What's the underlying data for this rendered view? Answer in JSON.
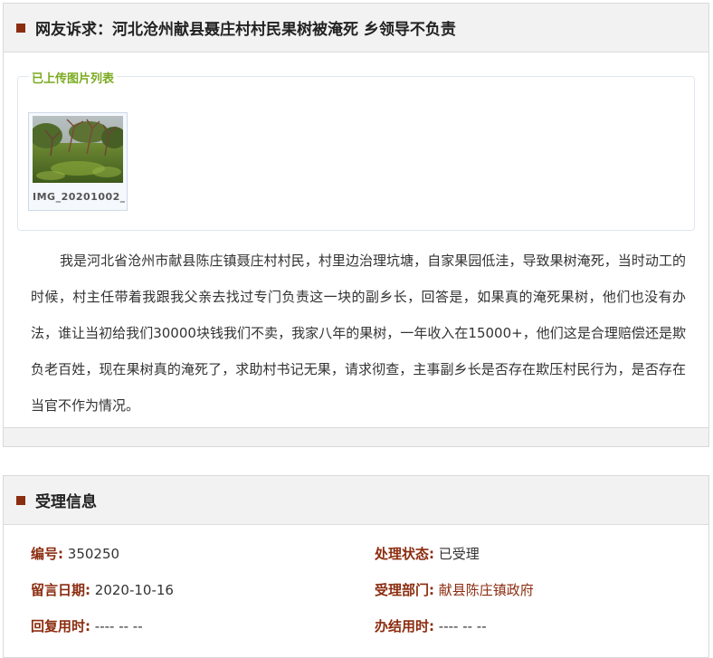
{
  "complaint": {
    "title": "网友诉求：河北沧州献县聂庄村村民果树被淹死 乡领导不负责",
    "uploaded_label": "已上传图片列表",
    "image_filename": "IMG_20201002_1",
    "body": "我是河北省沧州市献县陈庄镇聂庄村村民，村里边治理坑塘，自家果园低洼，导致果树淹死，当时动工的时候，村主任带着我跟我父亲去找过专门负责这一块的副乡长，回答是，如果真的淹死果树，他们也没有办法，谁让当初给我们30000块钱我们不卖，我家八年的果树，一年收入在15000+，他们这是合理赔偿还是欺负老百姓，现在果树真的淹死了，求助村书记无果，请求彻查，主事副乡长是否存在欺压村民行为，是否存在当官不作为情况。"
  },
  "acceptance": {
    "title": "受理信息",
    "number_label": "编号:",
    "number_value": "350250",
    "status_label": "处理状态:",
    "status_value": "已受理",
    "date_label": "留言日期:",
    "date_value": "2020-10-16",
    "dept_label": "受理部门:",
    "dept_value": "献县陈庄镇政府",
    "reply_time_label": "回复用时:",
    "reply_time_value": "---- -- --",
    "finish_time_label": "办结用时:",
    "finish_time_value": "---- -- --"
  },
  "colors": {
    "accent": "#8b2d10",
    "legend": "#7aaa1f"
  }
}
